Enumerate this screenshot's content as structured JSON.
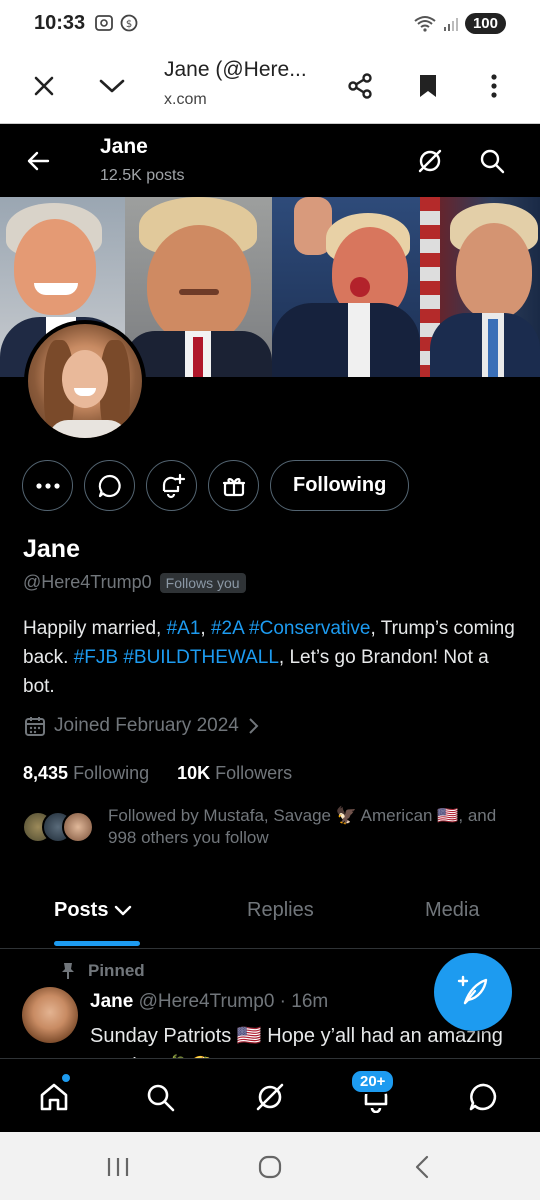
{
  "status_bar": {
    "time": "10:33",
    "battery": "100"
  },
  "browser": {
    "title": "Jane (@Here...",
    "url": "x.com"
  },
  "profile_header": {
    "name": "Jane",
    "posts_count": "12.5K posts"
  },
  "profile": {
    "display_name": "Jane",
    "handle": "@Here4Trump0",
    "follows_you": "Follows you",
    "bio": {
      "p1": "Happily married, ",
      "t1": "#A1",
      "p2": ", ",
      "t2": "#2A",
      "p3": " ",
      "t3": "#Conservative",
      "p4": ", Trump’s coming back. ",
      "t4": "#FJB",
      "p5": " ",
      "t5": "#BUILDTHEWALL",
      "p6": ", Let’s go Brandon! Not a bot."
    },
    "joined": "Joined February 2024",
    "following_count": "8,435",
    "following_label": "Following",
    "followers_count": "10K",
    "followers_label": "Followers",
    "followed_by": "Followed by Mustafa, Savage 🦅 American 🇺🇸, and 998 others you follow",
    "following_button": "Following"
  },
  "tabs": [
    "Posts",
    "Replies",
    "Media"
  ],
  "post": {
    "pinned_label": "Pinned",
    "author": "Jane",
    "meta": " @Here4Trump0 · 16m",
    "text": "Sunday Patriots 🇺🇸 Hope y’all had an amazing Sunday 🌴🌮"
  },
  "bottom_nav": {
    "notifications_badge": "20+"
  },
  "colors": {
    "accent": "#1d9bf0",
    "background": "#000000",
    "secondary_text": "#71767b"
  }
}
